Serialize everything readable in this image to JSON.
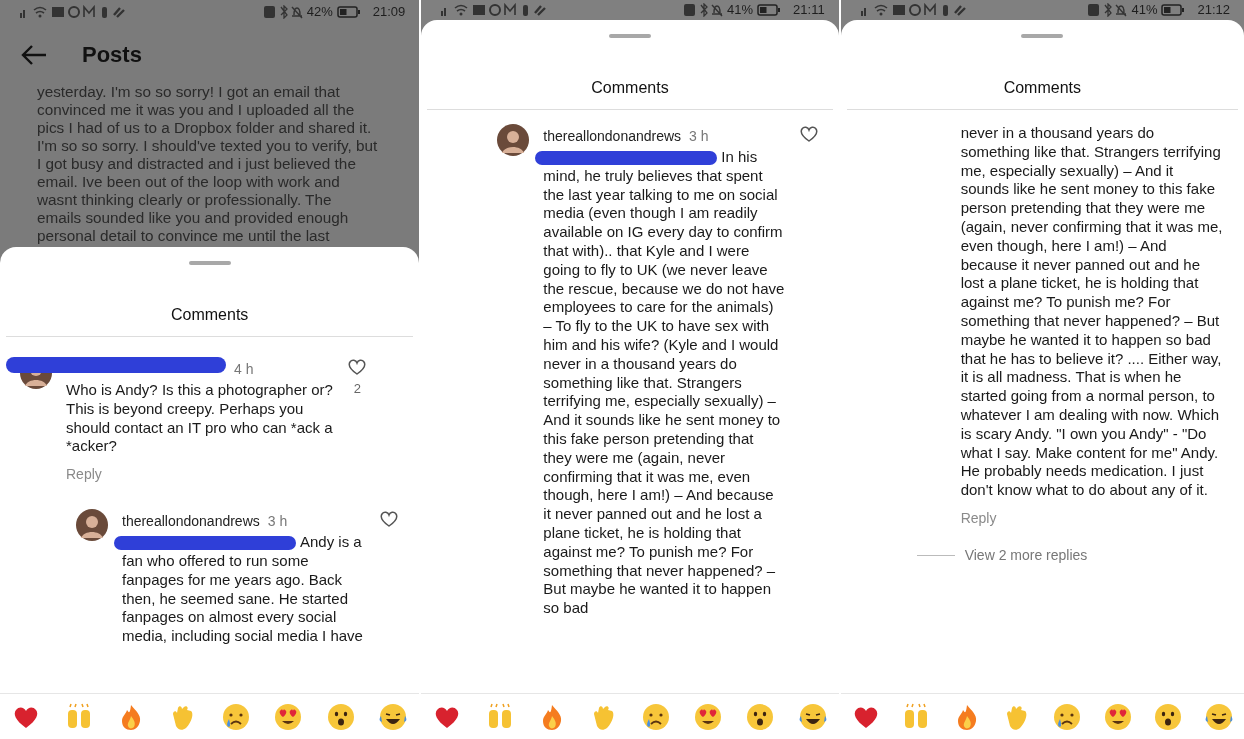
{
  "panels": [
    {
      "status_bar": {
        "battery": "42%",
        "time": "21:09"
      },
      "dimmed": true,
      "header": {
        "title": "Posts"
      },
      "post_text": "yesterday. I'm so so sorry! I got an email that convinced me it was you and I uploaded all the pics I had of us to a Dropbox folder and shared it. I'm so so sorry. I should've texted you to verify, but I got busy and distracted and i just believed the email. Ive been out of the loop with work and wasnt thinking clearly or professionally. The emails sounded like you and provided enough personal detail to convince me until the last",
      "sheet": {
        "title": "Comments",
        "comments": [
          {
            "redacted_name": true,
            "time": "4 h",
            "text": "Who is Andy? Is this a photographer or?  This is beyond creepy. Perhaps you should contact an IT pro who can *ack a *acker?",
            "likes": "2",
            "reply": "Reply",
            "children": [
              {
                "username": "thereallondonandrews",
                "time": "3 h",
                "redacted_lead": true,
                "text": "Andy is a fan who offered to run some fanpages for me years ago. Back then, he seemed sane. He started fanpages on almost every social media, including social media I have"
              }
            ]
          }
        ]
      }
    },
    {
      "status_bar": {
        "battery": "41%",
        "time": "21:11"
      },
      "dimmed": false,
      "sheet": {
        "title": "Comments",
        "comments": [
          {
            "indented": true,
            "username": "thereallondonandrews",
            "time": "3 h",
            "redacted_lead": true,
            "text": "In his mind, he truly believes that spent the last year talking to me on social media (even though I am readily available on IG every day to confirm that with).. that Kyle and I were going to fly to UK (we never leave the rescue, because we do not have employees to care for the animals) – To fly to the UK to have sex with him and his wife? (Kyle and I would never in a thousand years do something like that. Strangers terrifying me, especially sexually) – And it sounds like he sent money to this fake person pretending that they were me (again, never confirming that it was me, even though, here I am!) – And because it never panned out and he lost a plane ticket, he is holding that against me? To punish me? For something that never happened? – But maybe he wanted it to happen so bad"
          }
        ]
      }
    },
    {
      "status_bar": {
        "battery": "41%",
        "time": "21:12"
      },
      "dimmed": false,
      "sheet": {
        "title": "Comments",
        "comments": [
          {
            "indented": true,
            "text": "never in a thousand years do something like that. Strangers terrifying me, especially sexually) – And it sounds like he sent money to this fake person pretending that they were me (again, never confirming that it was me, even though, here I am!) – And because it never panned out and he lost a plane ticket, he is holding that against me? To punish me? For something that never happened? – But maybe he wanted it to happen so bad that he has to believe it? .... Either way, it is all madness. That is when he started going from a normal person, to whatever I am dealing with now. Which is scary Andy. \"I own you Andy\" - \"Do what I say. Make content for me\" Andy. He probably needs medication. I just don't know what to do about any of it.",
            "reply": "Reply",
            "more_replies": "View 2 more replies"
          }
        ]
      }
    }
  ]
}
